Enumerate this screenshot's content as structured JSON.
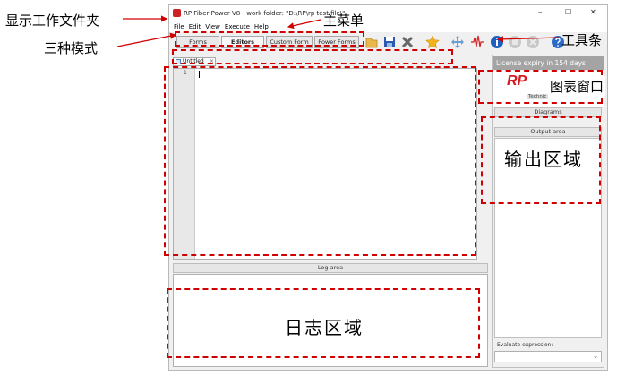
{
  "annotations": {
    "work_folder": "显示工作文件夹",
    "main_menu": "主菜单",
    "three_modes": "三种模式",
    "toolbar": "工具条",
    "diagram_window": "图表窗口",
    "output_region": "输出区域",
    "log_region": "日志区域"
  },
  "window": {
    "title": "RP Fiber Power V8 - work folder: \"D:\\RP\\rp test file\\\"",
    "controls": {
      "minimize": "–",
      "maximize": "☐",
      "close": "✕"
    }
  },
  "menu": [
    "File",
    "Edit",
    "View",
    "Execute",
    "Help"
  ],
  "modes": [
    "Forms",
    "Editors",
    "Custom Form",
    "Power Forms"
  ],
  "active_mode": "Editors",
  "toolbar_icons": [
    "open-folder-icon",
    "save-icon",
    "delete-icon",
    "star-icon",
    "move-icon",
    "signal-icon",
    "info-icon",
    "stop-icon",
    "cancel-icon",
    "help-icon"
  ],
  "editor": {
    "tab_label": "Untitled",
    "line_number": "1"
  },
  "log": {
    "header": "Log area"
  },
  "right_panel": {
    "license": "License expiry in 154 days",
    "logo_text": "RP",
    "logo_sub": "Technic",
    "diagrams_tab": "Diagrams",
    "output_header": "Output area",
    "evaluate_label": "Evaluate expression:"
  },
  "colors": {
    "accent_red": "#d00000",
    "logo_red": "#d71920",
    "license_bar": "#a4a4a4"
  }
}
